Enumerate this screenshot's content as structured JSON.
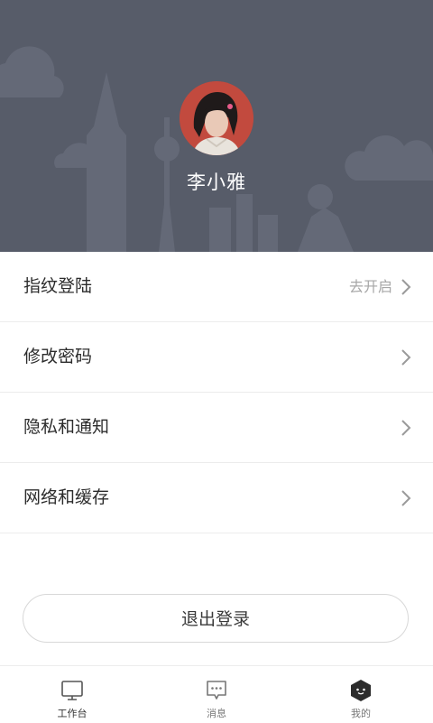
{
  "profile": {
    "name": "李小雅"
  },
  "menu": {
    "items": [
      {
        "label": "指纹登陆",
        "value": "去开启"
      },
      {
        "label": "修改密码",
        "value": ""
      },
      {
        "label": "隐私和通知",
        "value": ""
      },
      {
        "label": "网络和缓存",
        "value": ""
      }
    ]
  },
  "logout_label": "退出登录",
  "tabbar": {
    "tabs": [
      {
        "label": "工作台",
        "icon": "monitor-icon"
      },
      {
        "label": "消息",
        "icon": "message-icon"
      },
      {
        "label": "我的",
        "icon": "profile-hexagon-icon",
        "active": true
      }
    ]
  },
  "colors": {
    "header_bg": "#575c69",
    "text_primary": "#2c2c2c",
    "text_muted": "#a7a7a7",
    "divider": "#ececec"
  }
}
